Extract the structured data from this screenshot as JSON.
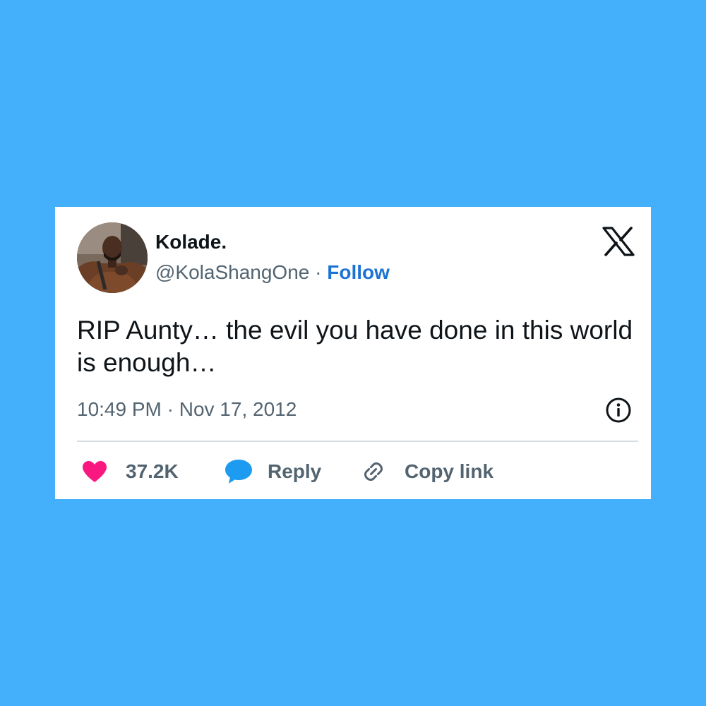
{
  "tweet": {
    "author": {
      "name": "Kolade.",
      "handle": "@KolaShangOne",
      "separator": " · ",
      "follow_label": "Follow"
    },
    "text": "RIP Aunty… the evil you have done in this world is enough…",
    "timestamp": "10:49 PM · Nov 17, 2012",
    "actions": {
      "likes": "37.2K",
      "reply_label": "Reply",
      "copy_label": "Copy link"
    },
    "icons": {
      "brand": "x-logo-icon",
      "info": "info-icon",
      "like": "heart-icon",
      "reply": "speech-bubble-icon",
      "copy": "link-icon"
    }
  },
  "colors": {
    "background": "#44b0fb",
    "card": "#ffffff",
    "follow": "#1d73d4",
    "heart": "#f91880",
    "reply_bubble": "#1d9bf0",
    "muted_text": "#536471",
    "main_text": "#0f1419"
  }
}
